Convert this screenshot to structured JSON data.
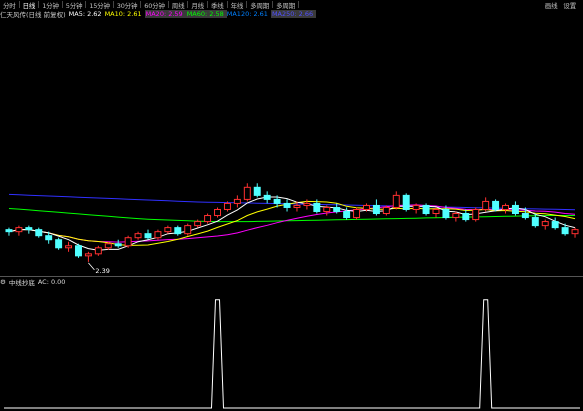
{
  "toolbar": {
    "items": [
      "分时",
      "日线",
      "1分钟",
      "5分钟",
      "15分钟",
      "30分钟",
      "60分钟",
      "周线",
      "月线",
      "季线",
      "年线",
      "多周期",
      "多周期"
    ],
    "active_index": 1,
    "right": [
      "画线",
      "设置"
    ]
  },
  "info": {
    "title": "仁天风传(日线 前复权)",
    "ma5": "MA5: 2.62",
    "ma10": "MA10: 2.61",
    "ma20": "MA20: 2.59",
    "ma60": "MA60: 2.58",
    "ma120": "MA120: 2.61",
    "ma250": "MA250: 2.66"
  },
  "price_low_label": "2.39",
  "indicator": {
    "name": "中线抄底",
    "value": "AC: 0.00"
  },
  "colors": {
    "up": "#ff3030",
    "down": "#50ffff",
    "ma5": "#ffffff",
    "ma10": "#ffff00",
    "ma20": "#ff00ff",
    "ma60": "#00ff00",
    "ma120": "#3030ff"
  },
  "candles": [
    [
      2.55,
      2.56,
      2.52,
      2.54
    ],
    [
      2.54,
      2.57,
      2.52,
      2.56
    ],
    [
      2.56,
      2.57,
      2.53,
      2.55
    ],
    [
      2.55,
      2.56,
      2.51,
      2.52
    ],
    [
      2.52,
      2.54,
      2.48,
      2.5
    ],
    [
      2.5,
      2.51,
      2.45,
      2.46
    ],
    [
      2.46,
      2.49,
      2.44,
      2.47
    ],
    [
      2.47,
      2.48,
      2.41,
      2.42
    ],
    [
      2.42,
      2.44,
      2.39,
      2.43
    ],
    [
      2.43,
      2.47,
      2.42,
      2.46
    ],
    [
      2.46,
      2.49,
      2.45,
      2.48
    ],
    [
      2.48,
      2.5,
      2.46,
      2.47
    ],
    [
      2.47,
      2.52,
      2.46,
      2.51
    ],
    [
      2.51,
      2.54,
      2.5,
      2.53
    ],
    [
      2.53,
      2.55,
      2.5,
      2.51
    ],
    [
      2.51,
      2.55,
      2.5,
      2.54
    ],
    [
      2.54,
      2.57,
      2.53,
      2.56
    ],
    [
      2.56,
      2.57,
      2.52,
      2.53
    ],
    [
      2.53,
      2.58,
      2.52,
      2.57
    ],
    [
      2.57,
      2.6,
      2.56,
      2.59
    ],
    [
      2.59,
      2.63,
      2.58,
      2.62
    ],
    [
      2.62,
      2.66,
      2.61,
      2.65
    ],
    [
      2.65,
      2.69,
      2.64,
      2.68
    ],
    [
      2.68,
      2.72,
      2.66,
      2.7
    ],
    [
      2.7,
      2.78,
      2.69,
      2.76
    ],
    [
      2.76,
      2.78,
      2.71,
      2.72
    ],
    [
      2.72,
      2.74,
      2.68,
      2.7
    ],
    [
      2.7,
      2.72,
      2.66,
      2.68
    ],
    [
      2.68,
      2.7,
      2.64,
      2.66
    ],
    [
      2.66,
      2.69,
      2.64,
      2.67
    ],
    [
      2.67,
      2.7,
      2.65,
      2.68
    ],
    [
      2.68,
      2.7,
      2.63,
      2.64
    ],
    [
      2.64,
      2.67,
      2.62,
      2.66
    ],
    [
      2.66,
      2.68,
      2.63,
      2.64
    ],
    [
      2.64,
      2.66,
      2.6,
      2.61
    ],
    [
      2.61,
      2.66,
      2.6,
      2.65
    ],
    [
      2.65,
      2.68,
      2.64,
      2.67
    ],
    [
      2.67,
      2.7,
      2.62,
      2.63
    ],
    [
      2.63,
      2.67,
      2.62,
      2.66
    ],
    [
      2.66,
      2.74,
      2.65,
      2.72
    ],
    [
      2.72,
      2.73,
      2.64,
      2.65
    ],
    [
      2.65,
      2.68,
      2.63,
      2.67
    ],
    [
      2.67,
      2.68,
      2.62,
      2.63
    ],
    [
      2.63,
      2.66,
      2.61,
      2.65
    ],
    [
      2.65,
      2.67,
      2.6,
      2.61
    ],
    [
      2.61,
      2.64,
      2.59,
      2.63
    ],
    [
      2.63,
      2.65,
      2.59,
      2.6
    ],
    [
      2.6,
      2.66,
      2.59,
      2.65
    ],
    [
      2.65,
      2.71,
      2.64,
      2.69
    ],
    [
      2.69,
      2.7,
      2.64,
      2.65
    ],
    [
      2.65,
      2.68,
      2.63,
      2.67
    ],
    [
      2.67,
      2.69,
      2.62,
      2.63
    ],
    [
      2.63,
      2.66,
      2.6,
      2.61
    ],
    [
      2.61,
      2.63,
      2.56,
      2.57
    ],
    [
      2.57,
      2.6,
      2.55,
      2.59
    ],
    [
      2.59,
      2.61,
      2.55,
      2.56
    ],
    [
      2.56,
      2.58,
      2.52,
      2.53
    ],
    [
      2.53,
      2.56,
      2.51,
      2.55
    ]
  ],
  "ma60_series": [
    2.655,
    2.652,
    2.648,
    2.644,
    2.64,
    2.636,
    2.632,
    2.628,
    2.624,
    2.62,
    2.616,
    2.612,
    2.608,
    2.605,
    2.602,
    2.6,
    2.598,
    2.596,
    2.594,
    2.592,
    2.591,
    2.59,
    2.59,
    2.59,
    2.59,
    2.591,
    2.592,
    2.593,
    2.594,
    2.595,
    2.596,
    2.597,
    2.598,
    2.599,
    2.6,
    2.601,
    2.602,
    2.603,
    2.604,
    2.605,
    2.606,
    2.607,
    2.608,
    2.609,
    2.61,
    2.611,
    2.612,
    2.613,
    2.614,
    2.615,
    2.616,
    2.617,
    2.618,
    2.619,
    2.62,
    2.62,
    2.62,
    2.62
  ],
  "ma120_series": [
    2.725,
    2.723,
    2.721,
    2.719,
    2.717,
    2.715,
    2.713,
    2.711,
    2.709,
    2.707,
    2.705,
    2.703,
    2.701,
    2.699,
    2.697,
    2.695,
    2.693,
    2.691,
    2.689,
    2.687,
    2.686,
    2.685,
    2.684,
    2.683,
    2.682,
    2.681,
    2.68,
    2.679,
    2.678,
    2.677,
    2.676,
    2.675,
    2.674,
    2.673,
    2.672,
    2.671,
    2.67,
    2.669,
    2.668,
    2.667,
    2.666,
    2.665,
    2.664,
    2.663,
    2.662,
    2.661,
    2.66,
    2.659,
    2.658,
    2.657,
    2.656,
    2.655,
    2.654,
    2.653,
    2.652,
    2.651,
    2.65,
    2.649
  ],
  "signals": [
    {
      "candle_index": 21,
      "value": 1
    },
    {
      "candle_index": 48,
      "value": 1
    }
  ],
  "scale": {
    "price_min": 2.32,
    "price_max": 3.6,
    "indicator_max": 1.1
  }
}
